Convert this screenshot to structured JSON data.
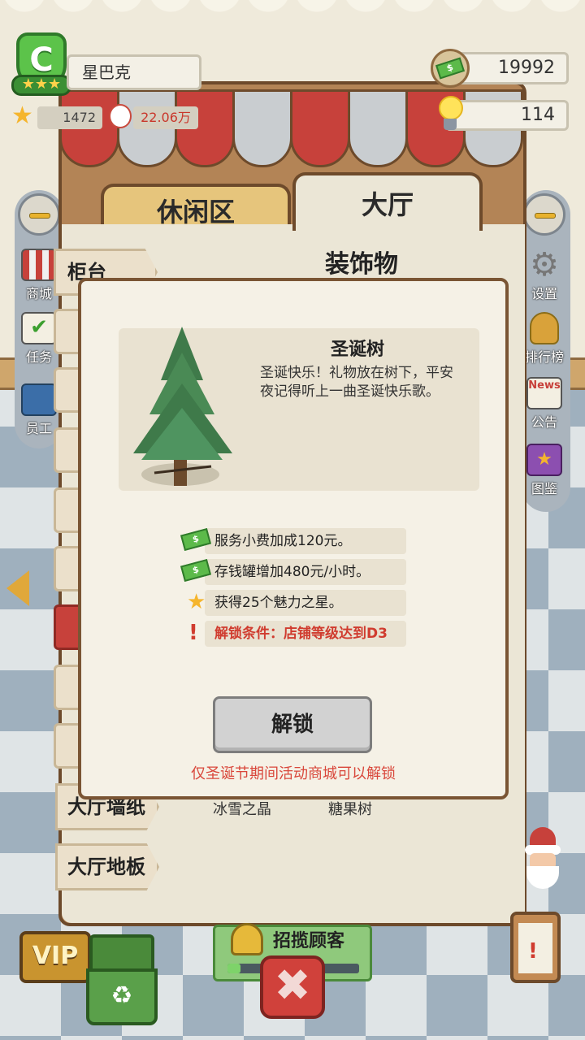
{
  "player": {
    "name": "星巴克",
    "rank_letter": "C",
    "rank_stars": "★★★",
    "stars": "1472",
    "popularity": "22.06万"
  },
  "currency": {
    "money": "19992",
    "ideas": "114",
    "bill_symbol": "$"
  },
  "shop": {
    "tabs": [
      {
        "label": "休闲区",
        "active": false
      },
      {
        "label": "大厅",
        "active": true
      }
    ],
    "section_title": "装饰物",
    "categories_top": [
      "柜台"
    ],
    "categories_bottom": [
      "大厅墙纸",
      "大厅地板"
    ],
    "behind_items": [
      "冰雪之晶",
      "糖果树"
    ]
  },
  "left_menu": {
    "items": [
      {
        "label": "商城",
        "icon": "shop-icon"
      },
      {
        "label": "任务",
        "icon": "task-icon"
      },
      {
        "label": "员工",
        "icon": "staff-icon"
      }
    ]
  },
  "right_menu": {
    "items": [
      {
        "label": "设置",
        "icon": "gear-icon"
      },
      {
        "label": "排行榜",
        "icon": "trophy-icon"
      },
      {
        "label": "公告",
        "icon": "news-icon"
      },
      {
        "label": "图鉴",
        "icon": "album-icon"
      }
    ],
    "news_text": "News"
  },
  "dialog": {
    "item_name": "圣诞树",
    "item_desc": "圣诞快乐！礼物放在树下，平安夜记得听上一曲圣诞快乐歌。",
    "perks": [
      {
        "text": "服务小费加成120元。",
        "icon": "money-icon"
      },
      {
        "text": "存钱罐增加480元/小时。",
        "icon": "money-icon"
      },
      {
        "text": "获得25个魅力之星。",
        "icon": "star-icon"
      }
    ],
    "requirement": "解锁条件：店铺等级达到D3",
    "unlock_button": "解锁",
    "note": "仅圣诞节期间活动商城可以解锁"
  },
  "bottom": {
    "attract_label": "招揽顾客",
    "attract_progress": 0.1,
    "vip_label": "VIP",
    "close_symbol": "✖",
    "recycle_symbol": "♻"
  },
  "colors": {
    "accent_red": "#c7413b",
    "accent_green": "#5cba4a",
    "requirement_red": "#d03c2f",
    "frame_brown": "#6d4a2b"
  }
}
